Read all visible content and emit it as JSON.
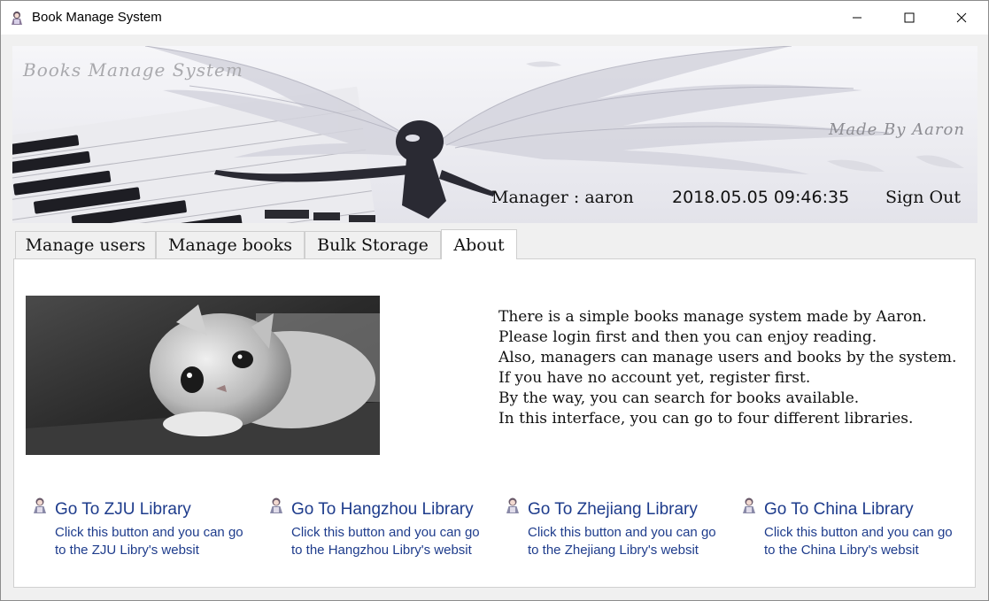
{
  "window": {
    "title": "Book Manage System"
  },
  "banner": {
    "title": "Books Manage System",
    "made_by": "Made By Aaron",
    "manager_label": "Manager : aaron",
    "datetime": "2018.05.05 09:46:35",
    "sign_out": "Sign Out"
  },
  "tabs": [
    {
      "label": "Manage users",
      "active": false
    },
    {
      "label": "Manage books",
      "active": false
    },
    {
      "label": "Bulk Storage",
      "active": false
    },
    {
      "label": "About",
      "active": true
    }
  ],
  "about": {
    "lines": [
      "There is a simple books manage system made by Aaron.",
      "Please login first and then you can enjoy reading.",
      "Also, managers can manage users and books by the system.",
      "If you have no account yet, register first.",
      "By the way, you can search for books available.",
      "In this interface, you can go to four different libraries."
    ]
  },
  "libraries": [
    {
      "title": "Go To ZJU Library",
      "desc_line1": "Click this button and you can go",
      "desc_line2": "to the ZJU Libry's websit"
    },
    {
      "title": "Go To Hangzhou Library",
      "desc_line1": "Click this button and you can go",
      "desc_line2": "to the Hangzhou Libry's websit"
    },
    {
      "title": "Go To Zhejiang Library",
      "desc_line1": "Click this button and you can go",
      "desc_line2": "to the Zhejiang Libry's websit"
    },
    {
      "title": "Go To China Library",
      "desc_line1": "Click this button and you can go",
      "desc_line2": "to the China Libry's websit"
    }
  ],
  "colors": {
    "link": "#1e3c8c",
    "window_bg": "#f0f0f0",
    "panel_bg": "#ffffff"
  },
  "icons": {
    "app": "character-icon",
    "minimize": "minimize-icon",
    "maximize": "maximize-icon",
    "close": "close-icon",
    "library": "character-icon"
  }
}
